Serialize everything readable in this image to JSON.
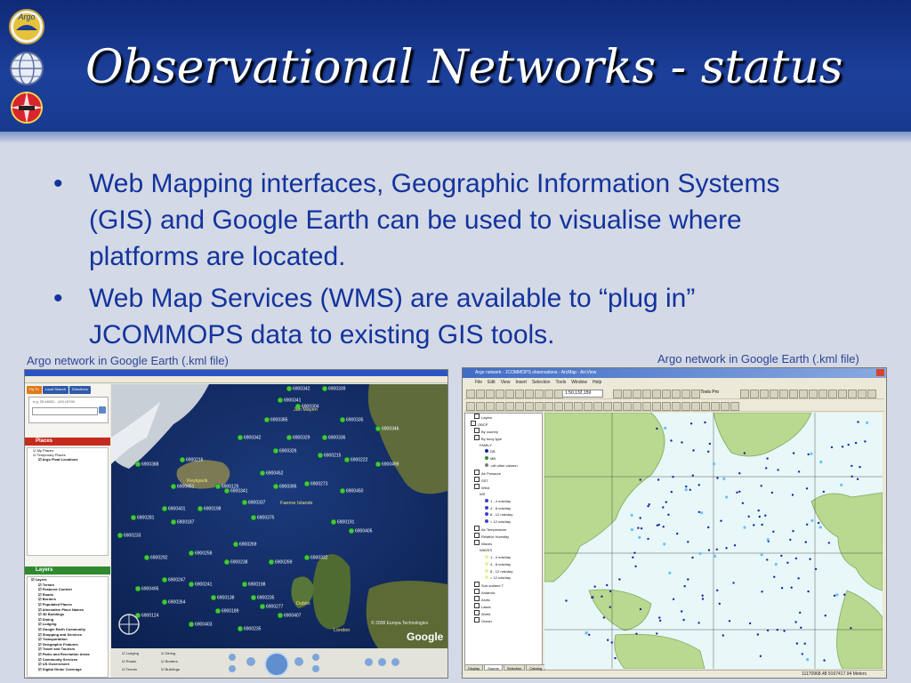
{
  "slide": {
    "title": "Observational Networks - status",
    "logos": [
      {
        "icon": "argo-logo",
        "text": "Argo"
      },
      {
        "icon": "jcommops-globe-logo"
      },
      {
        "icon": "ship-compass-logo"
      }
    ],
    "bullets": [
      "Web Mapping interfaces, Geographic Information Systems (GIS) and Google Earth can be used to visualise where platforms are located.",
      "Web Map Services (WMS) are available to “plug in” JCOMMOPS data to existing GIS tools."
    ],
    "bullet_symbol": "•"
  },
  "captions": {
    "left": "Argo network in Google Earth (.kml file)",
    "right": "Argo network in Google Earth (.kml file)"
  },
  "google_earth": {
    "tabs": [
      "Fly To",
      "Local Search",
      "Directions"
    ],
    "search_hint": "e.g. 25.46031, -103.19790",
    "places_header": "Places",
    "places": [
      "My Places",
      "Temporary Places",
      "Argo Float Locations"
    ],
    "layers_header": "Layers",
    "layers": [
      "Layers",
      "Terrain",
      "Featured Content",
      "Roads",
      "Borders",
      "Populated Places",
      "Alternative Place Names",
      "3D Buildings",
      "Dining",
      "Lodging",
      "Google Earth Community",
      "Shopping and Services",
      "Transportation",
      "Geographic Features",
      "Travel and Tourism",
      "Parks and Recreation Areas",
      "Community Services",
      "US Government",
      "Digital Globe Coverage"
    ],
    "bottom_toggles": [
      "Lodging",
      "Dining",
      "Roads",
      "Borders",
      "Terrain",
      "Buildings"
    ],
    "place_labels": [
      "Jan Mayen",
      "Reykjavik",
      "Faeroe Islands",
      "Dublin",
      "London"
    ],
    "float_ids": [
      "6900342",
      "6900339",
      "6900341",
      "6900304",
      "6900385",
      "6900335",
      "6900342",
      "6900329",
      "6900336",
      "6900346",
      "6900326",
      "6900215",
      "6900222",
      "6900499",
      "6900216",
      "6900388",
      "6900451",
      "6900125",
      "6900452",
      "6900341",
      "6900395",
      "6900273",
      "6900450",
      "6900337",
      "6900198",
      "6900401",
      "6900281",
      "6900233",
      "6900187",
      "6900375",
      "6900191",
      "6900405",
      "6900269",
      "6900258",
      "6900238",
      "6900292",
      "6900269",
      "6900332",
      "6900247",
      "6900241",
      "6900198",
      "6900138",
      "6900235",
      "6900264",
      "6900189",
      "6900277",
      "6900124",
      "6900403",
      "6900235",
      "6900407",
      "6900495"
    ],
    "copyright": "© 2008 Europa Technologies",
    "brand": "Google"
  },
  "arcmap": {
    "title": "Argo network - JCOMMOPS observations - ArcMap - ArcView",
    "menus": [
      "File",
      "Edit",
      "View",
      "Insert",
      "Selection",
      "Tools",
      "Window",
      "Help"
    ],
    "scale": "1:50,132,159",
    "tools_label": "XTools Pro",
    "toc": [
      "Layers",
      "OBCP",
      "By country",
      "By buoy type",
      "FAMILY",
      "DB",
      "MB",
      "<all other values>",
      "Air Pressure",
      "SST",
      "Wind",
      "WS",
      "1 - 4 nds/day",
      "4 - 8 nds/day",
      "8 - 12 nds/day",
      "> 12 nds/day",
      "Air Temperature",
      "Relative Humidity",
      "Waves",
      "WAVES",
      "1 - 4 nds/day",
      "4 - 8 nds/day",
      "8 - 12 nds/day",
      "> 12 nds/day",
      "Sub-surface T",
      "Antarctic",
      "Arctic",
      "Lakes",
      "World",
      "Ocean"
    ],
    "tabs": [
      "Display",
      "Source",
      "Selection",
      "Catalog"
    ],
    "status": "11170968.48  9167417.94 Meters",
    "colors": {
      "land": "#b8d98f",
      "ocean": "#e8f7f8",
      "float": "#1c23a6",
      "float_alt": "#66c2ff"
    }
  }
}
